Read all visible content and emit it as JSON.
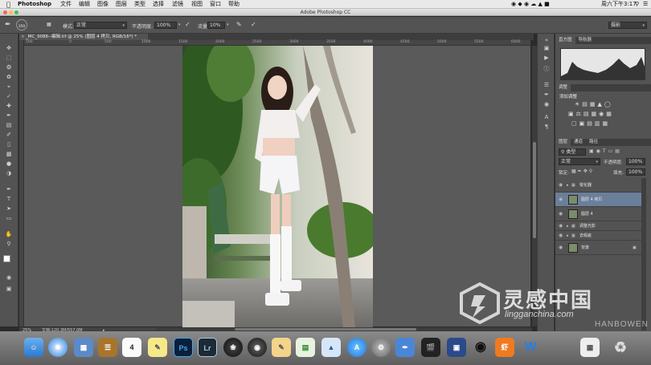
{
  "menubar": {
    "app": "Photoshop",
    "items": [
      "文件",
      "编辑",
      "图像",
      "图层",
      "类型",
      "选择",
      "滤镜",
      "视图",
      "窗口",
      "帮助"
    ],
    "clock": "周六下午3:17"
  },
  "window": {
    "title": "Adobe Photoshop CC"
  },
  "options": {
    "brush_size": "350",
    "mode_label": "模式:",
    "mode_value": "正常",
    "opacity_label": "不透明度:",
    "opacity_value": "100%",
    "flow_label": "流量:",
    "flow_value": "10%",
    "workspace": "摄影"
  },
  "document": {
    "tab_label": "_MC_9086--编辑.tif @ 25% (图层 4 拷贝, RGB/16*) *",
    "zoom": "25%",
    "file_info": "文档:120.3M/557.0M"
  },
  "ruler_ticks": [
    "500",
    "0",
    "500",
    "1000",
    "1500",
    "2000",
    "2500",
    "3000",
    "3500",
    "4000",
    "4500",
    "5000",
    "5500",
    "6000"
  ],
  "panels": {
    "histogram_tabs": [
      "直方图",
      "导航器"
    ],
    "adjust_tabs": [
      "调整"
    ],
    "adjust_title": "添加调整",
    "layer_tabs": [
      "图层",
      "通道",
      "路径"
    ],
    "kind_label": "类型",
    "blend_mode": "正常",
    "opacity_label": "不透明度:",
    "opacity_value": "100%",
    "lock_label": "锁定:",
    "fill_label": "填充:",
    "fill_value": "100%",
    "layers": [
      {
        "name": "锐化器",
        "type": "group",
        "selected": false
      },
      {
        "name": "图层 4 拷贝",
        "type": "layer",
        "selected": true
      },
      {
        "name": "图层 4",
        "type": "layer",
        "selected": false
      },
      {
        "name": "调整光影",
        "type": "group",
        "selected": false
      },
      {
        "name": "去瑕疵",
        "type": "group",
        "selected": false
      },
      {
        "name": "背景",
        "type": "layer",
        "selected": false
      }
    ]
  },
  "dock": {
    "apps": [
      "Finder",
      "Safari",
      "Preview",
      "Notes",
      "Calendar",
      "Stickies",
      "Ps",
      "Lr",
      "Aperture",
      "Camera",
      "Pages",
      "Numbers",
      "Keynote",
      "App Store",
      "System Preferences",
      "Xcode",
      "Final Cut",
      "Screen",
      "QQ",
      "虾",
      "W",
      "Preview",
      "Trash"
    ],
    "calendar_day": "4"
  },
  "watermark": {
    "brand": "灵感中国",
    "url": "lingganchina.com",
    "extra": "HANBOWEN"
  },
  "colors": {
    "menubar_bg": "#e9e9e9",
    "ps_panel": "#535353",
    "selected_layer": "#6a7f9a",
    "canvas_bg": "#5a5a5a"
  }
}
